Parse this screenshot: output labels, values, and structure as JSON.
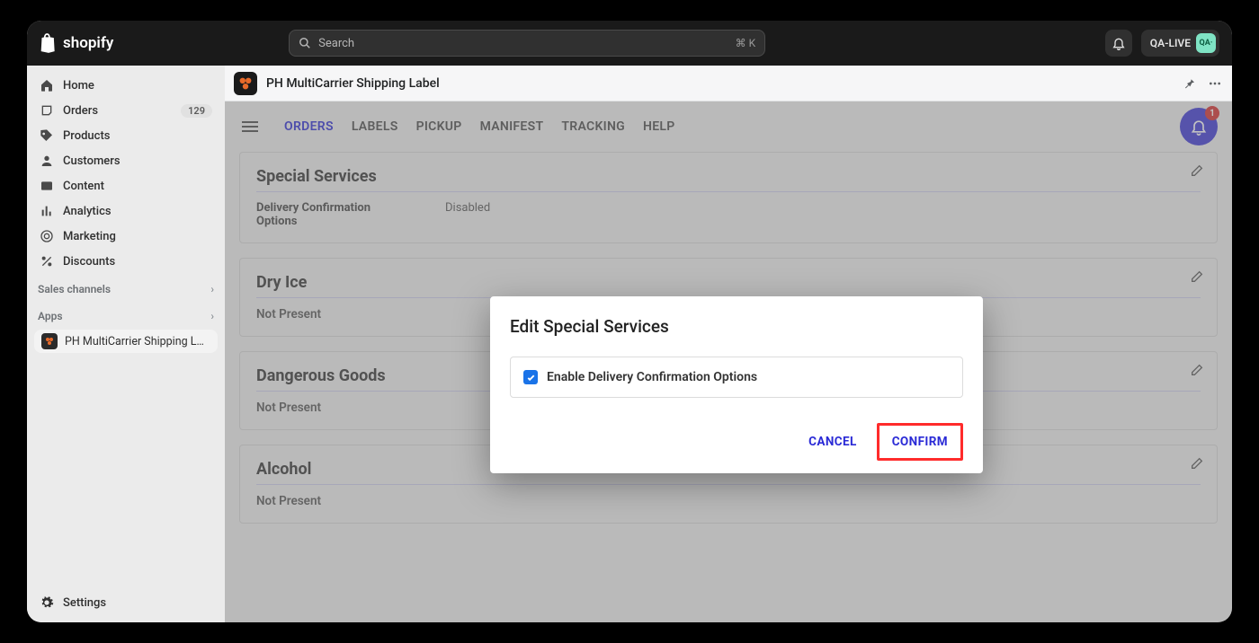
{
  "topbar": {
    "brand": "shopify",
    "search_placeholder": "Search",
    "search_kbd": "⌘ K",
    "tenant_label": "QA-LIVE",
    "tenant_avatar": "QA·"
  },
  "sidebar": {
    "items": [
      {
        "label": "Home"
      },
      {
        "label": "Orders",
        "badge": "129"
      },
      {
        "label": "Products"
      },
      {
        "label": "Customers"
      },
      {
        "label": "Content"
      },
      {
        "label": "Analytics"
      },
      {
        "label": "Marketing"
      },
      {
        "label": "Discounts"
      }
    ],
    "sales_channels_label": "Sales channels",
    "apps_label": "Apps",
    "app_item_label": "PH MultiCarrier Shipping L…",
    "settings_label": "Settings"
  },
  "app_header": {
    "title": "PH MultiCarrier Shipping Label"
  },
  "app_nav": {
    "tabs": [
      "ORDERS",
      "LABELS",
      "PICKUP",
      "MANIFEST",
      "TRACKING",
      "HELP"
    ],
    "active_index": 0,
    "bell_badge": "1"
  },
  "cards": {
    "special_services": {
      "title": "Special Services",
      "key": "Delivery Confirmation Options",
      "value": "Disabled"
    },
    "dry_ice": {
      "title": "Dry Ice",
      "status": "Not Present"
    },
    "dangerous_goods": {
      "title": "Dangerous Goods",
      "status": "Not Present"
    },
    "alcohol": {
      "title": "Alcohol",
      "status": "Not Present"
    }
  },
  "modal": {
    "title": "Edit Special Services",
    "checkbox_label": "Enable Delivery Confirmation Options",
    "checkbox_checked": true,
    "cancel_label": "CANCEL",
    "confirm_label": "CONFIRM"
  }
}
